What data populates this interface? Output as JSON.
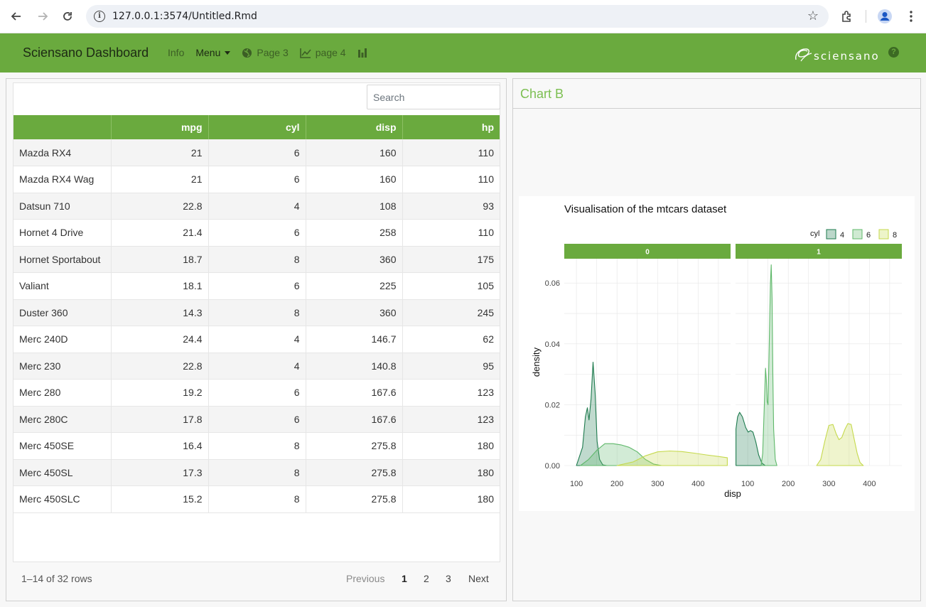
{
  "browser": {
    "url": "127.0.0.1:3574/Untitled.Rmd"
  },
  "navbar": {
    "brand": "Sciensano Dashboard",
    "items": [
      {
        "label": "Info",
        "icon": ""
      },
      {
        "label": "Menu",
        "icon": "caret-down-icon"
      },
      {
        "label": "Page 3",
        "icon": "globe-icon"
      },
      {
        "label": "page 4",
        "icon": "line-chart-icon"
      },
      {
        "label": "",
        "icon": "bar-chart-icon"
      }
    ],
    "logo_text": "sciensano",
    "help_glyph": "?"
  },
  "table": {
    "search_placeholder": "Search",
    "columns": [
      "",
      "mpg",
      "cyl",
      "disp",
      "hp"
    ],
    "rows": [
      [
        "Mazda RX4",
        "21",
        "6",
        "160",
        "110"
      ],
      [
        "Mazda RX4 Wag",
        "21",
        "6",
        "160",
        "110"
      ],
      [
        "Datsun 710",
        "22.8",
        "4",
        "108",
        "93"
      ],
      [
        "Hornet 4 Drive",
        "21.4",
        "6",
        "258",
        "110"
      ],
      [
        "Hornet Sportabout",
        "18.7",
        "8",
        "360",
        "175"
      ],
      [
        "Valiant",
        "18.1",
        "6",
        "225",
        "105"
      ],
      [
        "Duster 360",
        "14.3",
        "8",
        "360",
        "245"
      ],
      [
        "Merc 240D",
        "24.4",
        "4",
        "146.7",
        "62"
      ],
      [
        "Merc 230",
        "22.8",
        "4",
        "140.8",
        "95"
      ],
      [
        "Merc 280",
        "19.2",
        "6",
        "167.6",
        "123"
      ],
      [
        "Merc 280C",
        "17.8",
        "6",
        "167.6",
        "123"
      ],
      [
        "Merc 450SE",
        "16.4",
        "8",
        "275.8",
        "180"
      ],
      [
        "Merc 450SL",
        "17.3",
        "8",
        "275.8",
        "180"
      ],
      [
        "Merc 450SLC",
        "15.2",
        "8",
        "275.8",
        "180"
      ]
    ],
    "info": "1–14 of 32 rows",
    "pager": {
      "previous": "Previous",
      "pages": [
        "1",
        "2",
        "3"
      ],
      "current": "1",
      "next": "Next"
    }
  },
  "chart_panel": {
    "heading": "Chart B"
  },
  "chart_data": {
    "type": "area",
    "title": "Visualisation of the mtcars dataset",
    "xlabel": "disp",
    "ylabel": "density",
    "xlim": [
      70,
      480
    ],
    "ylim": [
      0,
      0.068
    ],
    "xticks": [
      100,
      200,
      300,
      400
    ],
    "yticks": [
      0.0,
      0.02,
      0.04,
      0.06
    ],
    "ytick_labels": [
      "0.00",
      "0.02",
      "0.04",
      "0.06"
    ],
    "grid": true,
    "legend": {
      "title": "cyl",
      "position": "top-right"
    },
    "facets": [
      "0",
      "1"
    ],
    "series": [
      {
        "name": "4",
        "facet": "0",
        "color": "#1e7b4e",
        "x": [
          100,
          115,
          122,
          127,
          131,
          136,
          141,
          146,
          151,
          157,
          165,
          175
        ],
        "y": [
          0.0,
          0.006,
          0.016,
          0.019,
          0.015,
          0.022,
          0.034,
          0.024,
          0.008,
          0.002,
          0.0002,
          0.0
        ]
      },
      {
        "name": "6",
        "facet": "0",
        "color": "#5fb86a",
        "x": [
          110,
          130,
          150,
          170,
          190,
          210,
          230,
          250,
          270,
          290,
          310
        ],
        "y": [
          0.0,
          0.002,
          0.005,
          0.0072,
          0.0072,
          0.0068,
          0.006,
          0.0045,
          0.002,
          0.0005,
          0.0
        ]
      },
      {
        "name": "8",
        "facet": "0",
        "color": "#c5d94c",
        "x": [
          200,
          240,
          270,
          300,
          330,
          360,
          390,
          420,
          450,
          472
        ],
        "y": [
          0.0,
          0.0012,
          0.0032,
          0.0045,
          0.0048,
          0.0046,
          0.0041,
          0.0035,
          0.003,
          0.0026
        ]
      },
      {
        "name": "4",
        "facet": "1",
        "color": "#1e7b4e",
        "x": [
          71,
          75,
          80,
          87,
          95,
          101,
          107,
          113,
          120,
          127,
          135,
          143
        ],
        "y": [
          0.012,
          0.016,
          0.0175,
          0.016,
          0.0125,
          0.011,
          0.0115,
          0.011,
          0.0078,
          0.0035,
          0.0008,
          0.0
        ]
      },
      {
        "name": "6",
        "facet": "1",
        "color": "#5fb86a",
        "x": [
          133,
          137,
          141,
          144,
          146,
          148,
          150,
          153,
          156,
          158,
          160,
          162,
          164,
          168,
          172
        ],
        "y": [
          0.0,
          0.004,
          0.02,
          0.032,
          0.028,
          0.021,
          0.02,
          0.04,
          0.06,
          0.066,
          0.055,
          0.03,
          0.012,
          0.002,
          0.0
        ]
      },
      {
        "name": "8",
        "facet": "1",
        "color": "#c5d94c",
        "x": [
          270,
          280,
          290,
          300,
          310,
          318,
          325,
          332,
          340,
          347,
          355,
          362,
          370,
          377,
          385
        ],
        "y": [
          0.0,
          0.002,
          0.008,
          0.0132,
          0.0135,
          0.0105,
          0.0085,
          0.0092,
          0.012,
          0.0138,
          0.0135,
          0.009,
          0.004,
          0.001,
          0.0
        ]
      }
    ]
  }
}
